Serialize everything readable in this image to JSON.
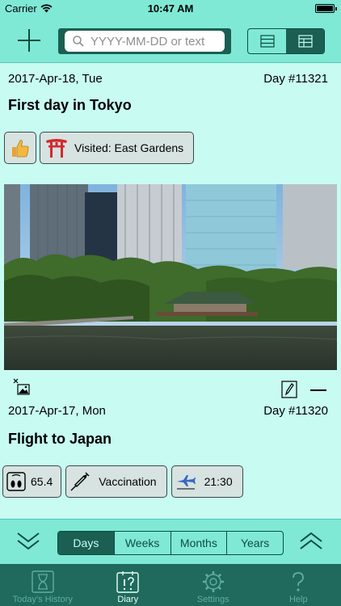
{
  "status_bar": {
    "carrier": "Carrier",
    "time": "10:47 AM"
  },
  "toolbar": {
    "search_placeholder": "YYYY-MM-DD or text",
    "view_options": [
      "list-icon",
      "detail-icon"
    ],
    "active_view": "detail-icon"
  },
  "entries": [
    {
      "date": "2017-Apr-18, Tue",
      "day": "Day #11321",
      "title": "First day in Tokyo",
      "tags": [
        {
          "icon": "thumbs-up-icon",
          "label": ""
        },
        {
          "icon": "torii-gate-icon",
          "label": "Visited: East Gardens"
        }
      ],
      "has_photo": true
    },
    {
      "date": "2017-Apr-17, Mon",
      "day": "Day #11320",
      "title": "Flight to Japan",
      "tags": [
        {
          "icon": "scale-icon",
          "label": "65.4"
        },
        {
          "icon": "syringe-icon",
          "label": "Vaccination"
        },
        {
          "icon": "airplane-icon",
          "label": "21:30"
        }
      ]
    }
  ],
  "range": {
    "segments": [
      "Days",
      "Weeks",
      "Months",
      "Years"
    ],
    "active": "Days"
  },
  "tabs": [
    {
      "label": "Today's History",
      "icon": "hourglass-icon"
    },
    {
      "label": "Diary",
      "icon": "diary-icon",
      "active": true
    },
    {
      "label": "Settings",
      "icon": "gear-icon"
    },
    {
      "label": "Help",
      "icon": "question-icon"
    }
  ],
  "colors": {
    "bar_bg": "#7fe9d6",
    "content_bg": "#c8fbf2",
    "accent_dark": "#1a5f52",
    "tab_bar_bg": "#1f6a5d"
  }
}
